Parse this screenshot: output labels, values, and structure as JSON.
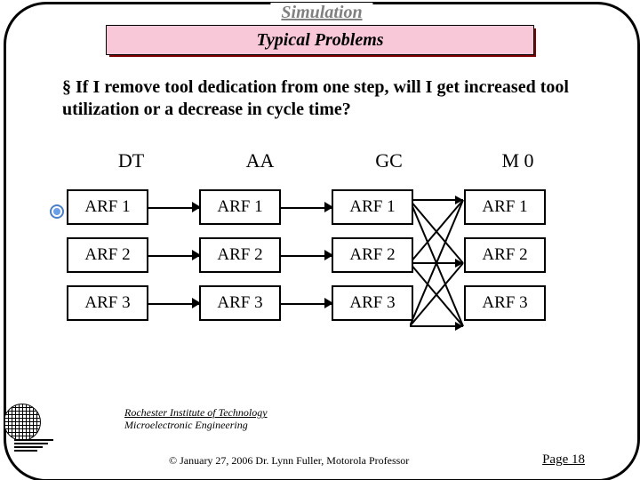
{
  "header": {
    "title": "Simulation",
    "subtitle": "Typical Problems"
  },
  "question": {
    "bullet": "§",
    "text": "If I remove tool dedication from one step, will I get increased tool utilization or a decrease in cycle time?"
  },
  "diagram": {
    "columns": [
      "DT",
      "AA",
      "GC",
      "M 0"
    ],
    "rows": [
      [
        "ARF 1",
        "ARF 1",
        "ARF 1",
        "ARF 1"
      ],
      [
        "ARF 2",
        "ARF 2",
        "ARF 2",
        "ARF 2"
      ],
      [
        "ARF 3",
        "ARF 3",
        "ARF 3",
        "ARF 3"
      ]
    ]
  },
  "footer": {
    "inst1": "Rochester Institute of Technology",
    "inst2": "Microelectronic Engineering",
    "copyright": "© January 27, 2006  Dr. Lynn Fuller, Motorola Professor",
    "page": "Page 18"
  }
}
